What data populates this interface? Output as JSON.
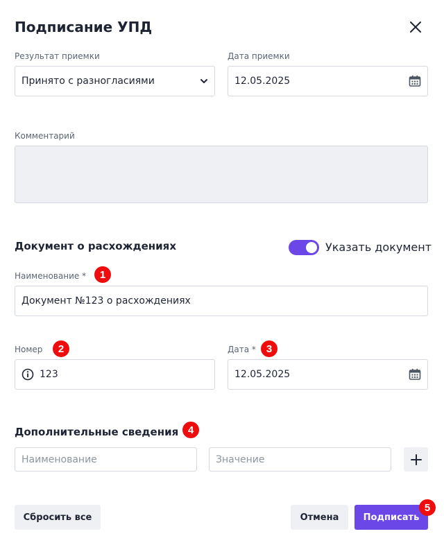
{
  "dialog": {
    "title": "Подписание УПД"
  },
  "acceptance": {
    "result_label": "Результат приемки",
    "result_value": "Принято с разногласиями",
    "date_label": "Дата приемки",
    "date_value": "12.05.2025"
  },
  "comment": {
    "label": "Комментарий",
    "value": ""
  },
  "discrepancy": {
    "section_title": "Документ о расхождениях",
    "toggle_label": "Указать документ",
    "toggle_on": true,
    "name_label": "Наименование *",
    "name_value": "Документ №123 о расхождениях",
    "number_label": "Номер",
    "number_value": "123",
    "date_label": "Дата *",
    "date_value": "12.05.2025"
  },
  "additional": {
    "section_title": "Дополнительные сведения",
    "name_placeholder": "Наименование",
    "value_placeholder": "Значение"
  },
  "footer": {
    "reset_label": "Сбросить все",
    "cancel_label": "Отмена",
    "sign_label": "Подписать"
  },
  "badges": [
    "1",
    "2",
    "3",
    "4",
    "5"
  ],
  "colors": {
    "accent": "#6b47e8",
    "badge": "#ee0c0c",
    "field_border": "#d4d9e0",
    "muted_bg": "#eef0f3"
  },
  "icons": {
    "close": "close-icon",
    "select_chevron": "chevron-down-icon",
    "calendar": "calendar-icon",
    "info": "info-icon",
    "add": "plus-icon"
  }
}
